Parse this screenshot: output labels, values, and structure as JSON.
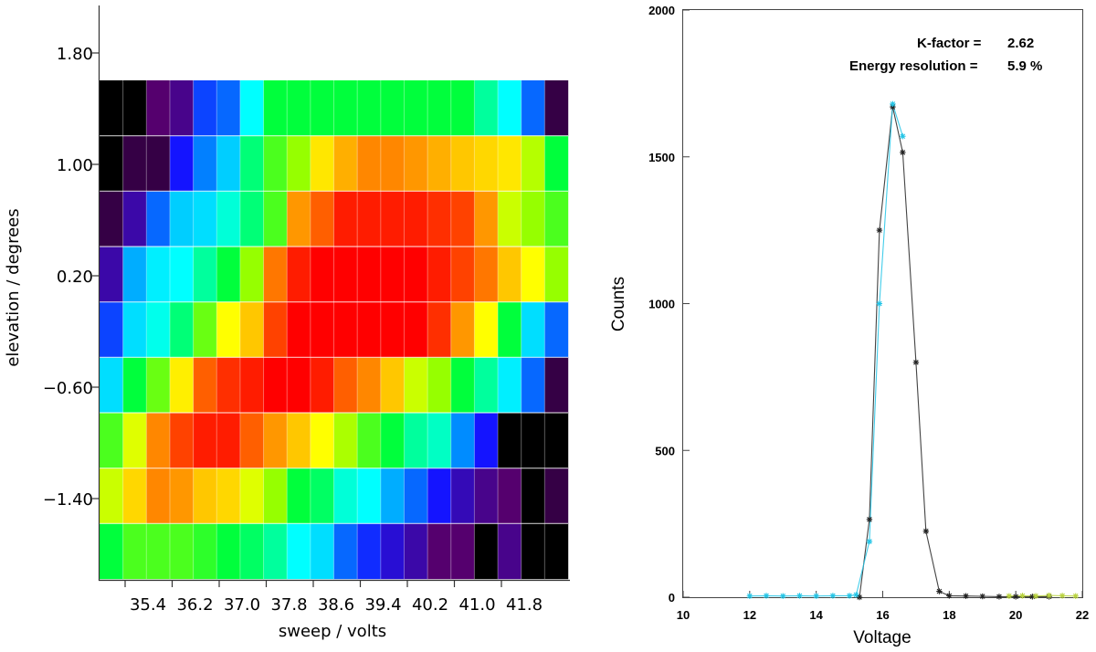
{
  "chart_data": [
    {
      "type": "heatmap",
      "xlabel": "sweep / volts",
      "ylabel": "elevation / degrees",
      "x_tick_labels": [
        "35.4",
        "36.2",
        "37.0",
        "37.8",
        "38.6",
        "39.4",
        "40.2",
        "41.0",
        "41.8"
      ],
      "y_tick_labels": [
        "1.80",
        "1.00",
        "0.20",
        "−0.60",
        "−1.40"
      ],
      "colormap": "rainbow (black → purple → blue → cyan → green → yellow → orange → red)",
      "value_range": [
        0,
        1
      ],
      "n_cols": 20,
      "rows_top_to_bottom": [
        [
          0.0,
          0.0,
          0.08,
          0.1,
          0.22,
          0.25,
          0.35,
          0.45,
          0.45,
          0.45,
          0.45,
          0.45,
          0.45,
          0.45,
          0.45,
          0.45,
          0.4,
          0.35,
          0.25,
          0.05
        ],
        [
          0.0,
          0.05,
          0.05,
          0.18,
          0.27,
          0.32,
          0.42,
          0.5,
          0.55,
          0.68,
          0.75,
          0.8,
          0.8,
          0.78,
          0.75,
          0.72,
          0.7,
          0.68,
          0.58,
          0.45
        ],
        [
          0.05,
          0.12,
          0.25,
          0.32,
          0.33,
          0.37,
          0.42,
          0.5,
          0.78,
          0.85,
          0.92,
          0.92,
          0.92,
          0.92,
          0.9,
          0.88,
          0.78,
          0.6,
          0.55,
          0.5
        ],
        [
          0.12,
          0.3,
          0.34,
          0.35,
          0.4,
          0.45,
          0.55,
          0.82,
          0.92,
          0.95,
          0.95,
          0.95,
          0.95,
          0.95,
          0.92,
          0.88,
          0.82,
          0.72,
          0.65,
          0.55
        ],
        [
          0.22,
          0.33,
          0.36,
          0.42,
          0.52,
          0.65,
          0.72,
          0.88,
          0.95,
          0.95,
          0.95,
          0.95,
          0.95,
          0.95,
          0.9,
          0.78,
          0.65,
          0.45,
          0.33,
          0.25
        ],
        [
          0.33,
          0.45,
          0.52,
          0.67,
          0.85,
          0.9,
          0.92,
          0.95,
          0.95,
          0.92,
          0.85,
          0.8,
          0.72,
          0.6,
          0.55,
          0.45,
          0.4,
          0.34,
          0.25,
          0.05
        ],
        [
          0.5,
          0.62,
          0.8,
          0.88,
          0.92,
          0.92,
          0.85,
          0.78,
          0.72,
          0.65,
          0.57,
          0.5,
          0.45,
          0.4,
          0.38,
          0.28,
          0.18,
          0.0,
          0.0,
          0.0
        ],
        [
          0.6,
          0.7,
          0.8,
          0.78,
          0.72,
          0.7,
          0.62,
          0.55,
          0.45,
          0.43,
          0.37,
          0.35,
          0.3,
          0.25,
          0.18,
          0.13,
          0.1,
          0.08,
          0.0,
          0.05
        ],
        [
          0.45,
          0.5,
          0.5,
          0.5,
          0.48,
          0.45,
          0.43,
          0.4,
          0.35,
          0.33,
          0.25,
          0.2,
          0.15,
          0.12,
          0.08,
          0.08,
          0.0,
          0.1,
          0.0,
          0.0
        ]
      ]
    },
    {
      "type": "line",
      "xlabel": "Voltage",
      "ylabel": "Counts",
      "xlim": [
        10,
        22
      ],
      "ylim": [
        0,
        2000
      ],
      "x_ticks": [
        10,
        12,
        14,
        16,
        18,
        20,
        22
      ],
      "y_ticks": [
        0,
        500,
        1000,
        1500,
        2000
      ],
      "annotations": [
        {
          "label": "K-factor =",
          "value": "2.62"
        },
        {
          "label": "Energy resolution =",
          "value": "5.9 %"
        }
      ],
      "series": [
        {
          "color": "#222222",
          "marker": "asterisk",
          "x": [
            15.3,
            15.6,
            15.9,
            16.3,
            16.6,
            17.0,
            17.3,
            17.7,
            18.0,
            18.5,
            19.0,
            19.5,
            20.0,
            20.5,
            21.0
          ],
          "y": [
            0,
            265,
            1250,
            1670,
            1515,
            800,
            225,
            20,
            5,
            4,
            3,
            2,
            2,
            2,
            2
          ]
        },
        {
          "color": "#22c4e6",
          "marker": "asterisk",
          "x": [
            12.0,
            12.5,
            13.0,
            13.5,
            14.0,
            14.5,
            15.0,
            15.2,
            15.6,
            15.9,
            16.3,
            16.6
          ],
          "y": [
            4,
            5,
            4,
            5,
            4,
            5,
            5,
            8,
            190,
            1000,
            1680,
            1570
          ]
        },
        {
          "color": "#b8d23c",
          "marker": "asterisk",
          "x": [
            19.8,
            20.2,
            20.6,
            21.0,
            21.4,
            21.8
          ],
          "y": [
            4,
            5,
            4,
            6,
            5,
            4
          ]
        }
      ]
    }
  ]
}
